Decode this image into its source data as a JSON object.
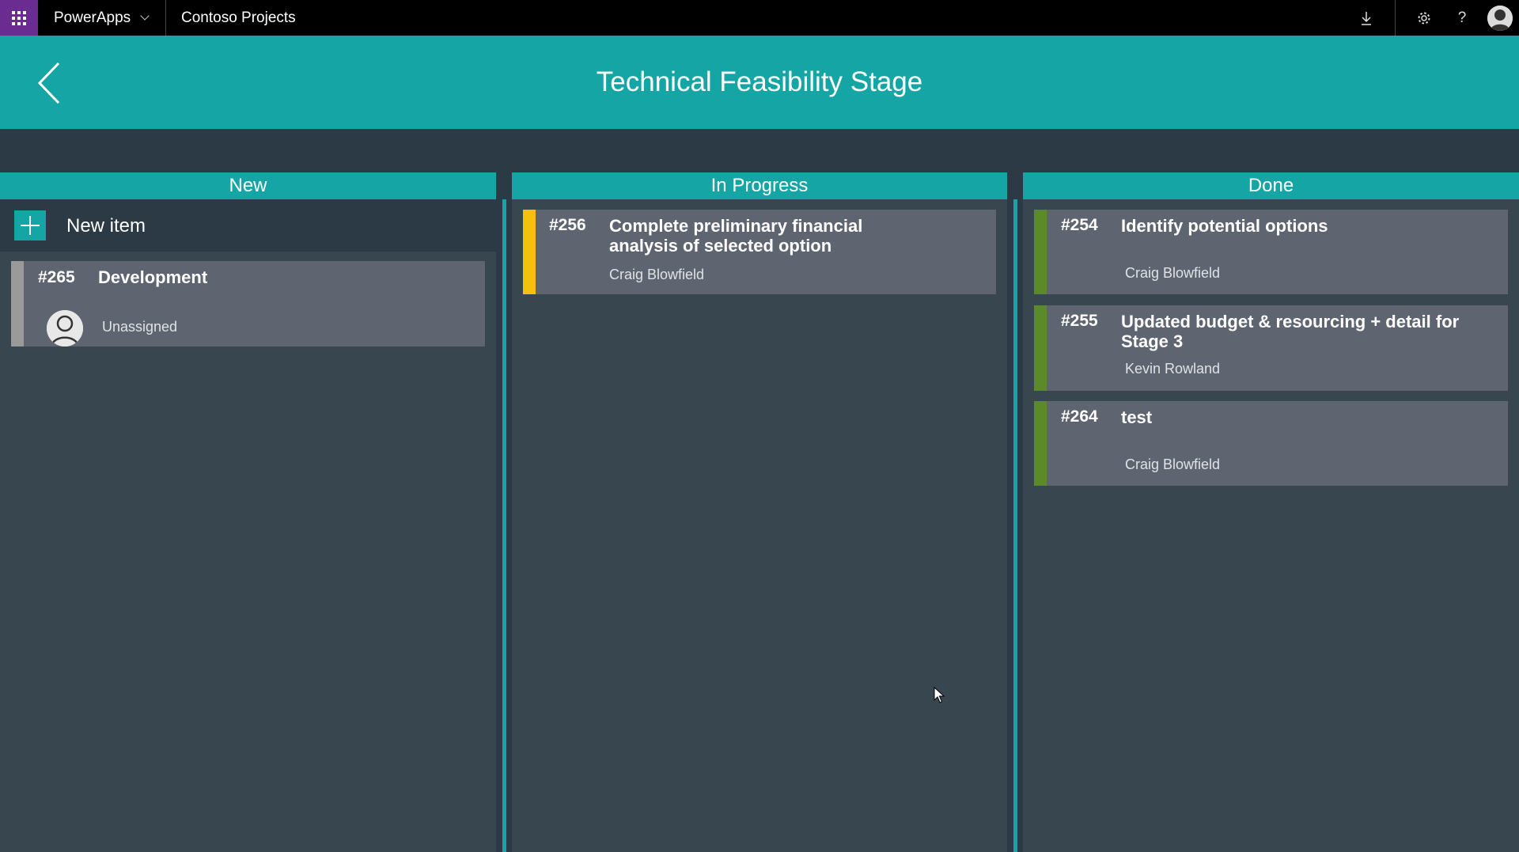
{
  "topbar": {
    "brand": "PowerApps",
    "app_name": "Contoso Projects",
    "icons": [
      "waffle-icon",
      "download-icon",
      "settings-icon",
      "help-icon",
      "user-avatar"
    ]
  },
  "header": {
    "title": "Technical Feasibility Stage",
    "back_icon": "back-arrow-icon"
  },
  "colors": {
    "accent": "#16a5a5",
    "suitebar": "#000000",
    "waffle": "#6b2c91",
    "background": "#2b3a45",
    "column_bg": "#37464f",
    "card_bg": "#5e6570",
    "stripe_new": "#9a9a9a",
    "stripe_in_progress": "#f4c20d",
    "stripe_done": "#5a8a2a"
  },
  "columns": {
    "new": {
      "label": "New",
      "add_label": "New item",
      "cards": [
        {
          "number": "#265",
          "title": "Development",
          "assignee": "Unassigned"
        }
      ]
    },
    "in_progress": {
      "label": "In Progress",
      "cards": [
        {
          "number": "#256",
          "title": "Complete preliminary financial analysis of selected option",
          "assignee": "Craig Blowfield"
        }
      ]
    },
    "done": {
      "label": "Done",
      "cards": [
        {
          "number": "#254",
          "title": "Identify potential options",
          "assignee": "Craig Blowfield"
        },
        {
          "number": "#255",
          "title": "Updated budget & resourcing + detail for Stage 3",
          "assignee": "Kevin Rowland"
        },
        {
          "number": "#264",
          "title": "test",
          "assignee": "Craig Blowfield"
        }
      ]
    }
  }
}
